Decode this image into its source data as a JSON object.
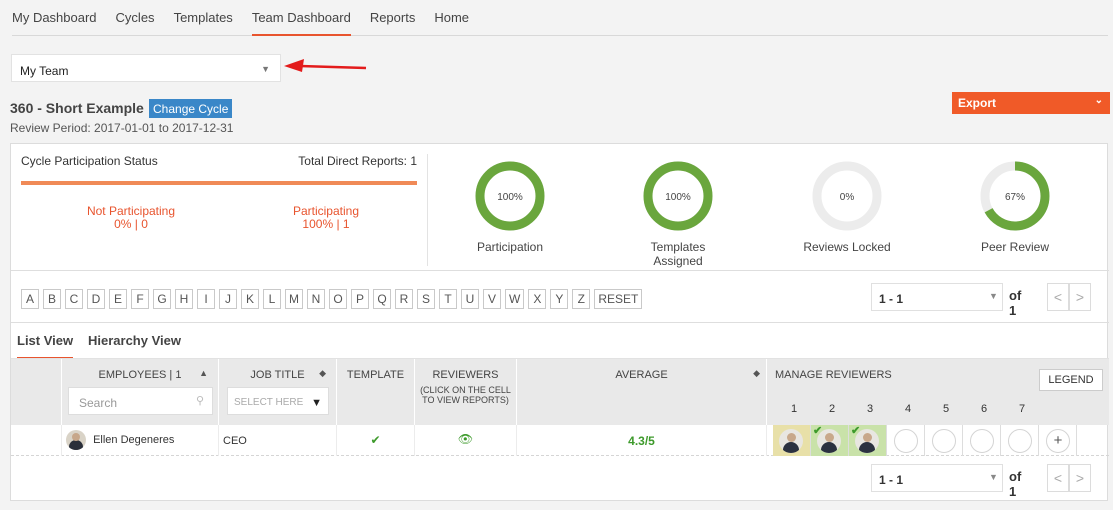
{
  "nav": {
    "items": [
      {
        "label": "My Dashboard"
      },
      {
        "label": "Cycles"
      },
      {
        "label": "Templates"
      },
      {
        "label": "Team Dashboard"
      },
      {
        "label": "Reports"
      },
      {
        "label": "Home"
      }
    ],
    "active_index": 3
  },
  "team_select": {
    "value": "My Team"
  },
  "cycle": {
    "title": "360 - Short Example",
    "change_label": "Change Cycle",
    "review_period": "Review Period: 2017-01-01 to 2017-12-31"
  },
  "export": {
    "label": "Export"
  },
  "status": {
    "title": "Cycle Participation Status",
    "total_direct": "Total Direct Reports: 1",
    "not_participating": {
      "label": "Not Participating",
      "value": "0% | 0"
    },
    "participating": {
      "label": "Participating",
      "value": "100% | 1"
    }
  },
  "donuts": [
    {
      "label": "Participation",
      "text": "100%",
      "percent": 100
    },
    {
      "label": "Templates Assigned",
      "text": "100%",
      "percent": 100
    },
    {
      "label": "Reviews Locked",
      "text": "0%",
      "percent": 0
    },
    {
      "label": "Peer Review",
      "text": "67%",
      "percent": 67
    }
  ],
  "alphabet": [
    "A",
    "B",
    "C",
    "D",
    "E",
    "F",
    "G",
    "H",
    "I",
    "J",
    "K",
    "L",
    "M",
    "N",
    "O",
    "P",
    "Q",
    "R",
    "S",
    "T",
    "U",
    "V",
    "W",
    "X",
    "Y",
    "Z",
    "RESET"
  ],
  "pager": {
    "range": "1 - 1",
    "of": "of 1",
    "prev": "<",
    "next": ">"
  },
  "tabs": [
    {
      "label": "List View"
    },
    {
      "label": "Hierarchy View"
    }
  ],
  "table": {
    "headers": {
      "employees": "EMPLOYEES | 1",
      "job_title": "JOB TITLE",
      "template": "TEMPLATE",
      "reviewers": "REVIEWERS",
      "reviewers_sub": "(CLICK ON THE CELL TO VIEW REPORTS)",
      "average": "AVERAGE",
      "manage": "MANAGE REVIEWERS"
    },
    "search_placeholder": "Search",
    "job_select": "SELECT HERE",
    "legend_label": "LEGEND",
    "reviewer_numbers": [
      "1",
      "2",
      "3",
      "4",
      "5",
      "6",
      "7"
    ],
    "rows": [
      {
        "name": "Ellen Degeneres",
        "job": "CEO",
        "template": "✔",
        "reviewers": "👁",
        "average": "4.3/5"
      }
    ]
  },
  "colors": {
    "accent": "#e8542e",
    "export": "#f05a28",
    "donut_green": "#6aa63d",
    "link_blue": "#3a87c8"
  }
}
